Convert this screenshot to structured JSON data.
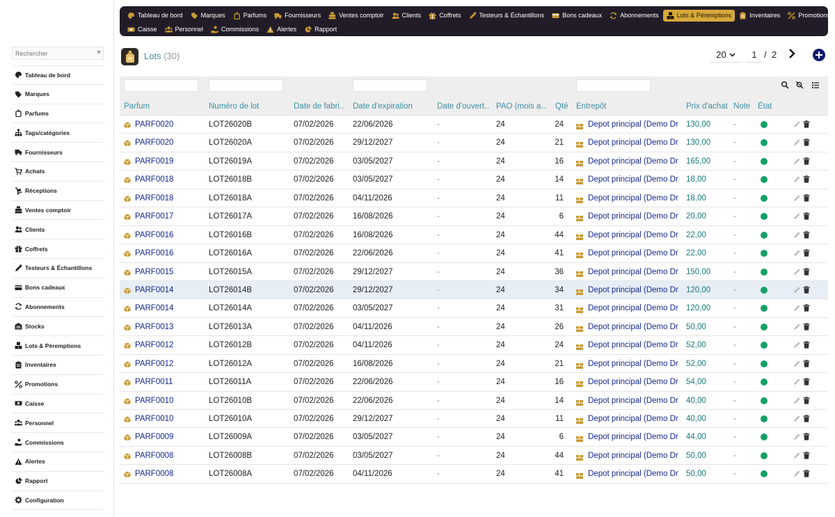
{
  "sidebar": {
    "search_placeholder": "Rechercher",
    "items": [
      {
        "label": "Tableau de bord",
        "icon": "palette-icon"
      },
      {
        "label": "Marques",
        "icon": "tag-icon"
      },
      {
        "label": "Parfums",
        "icon": "perfume-icon"
      },
      {
        "label": "Tags/catégories",
        "icon": "sitemap-icon"
      },
      {
        "label": "Fournisseurs",
        "icon": "truck-icon"
      },
      {
        "label": "Achats",
        "icon": "cart-icon"
      },
      {
        "label": "Réceptions",
        "icon": "dolly-icon"
      },
      {
        "label": "Ventes comptoir",
        "icon": "cash-register-icon"
      },
      {
        "label": "Clients",
        "icon": "users-icon"
      },
      {
        "label": "Coffrets",
        "icon": "gift-icon"
      },
      {
        "label": "Testeurs & Échantillons",
        "icon": "eyedropper-icon"
      },
      {
        "label": "Bons cadeaux",
        "icon": "credit-card-icon"
      },
      {
        "label": "Abonnements",
        "icon": "sync-icon"
      },
      {
        "label": "Stocks",
        "icon": "warehouse-icon"
      },
      {
        "label": "Lots & Péremptions",
        "icon": "boxes-icon"
      },
      {
        "label": "Inventaires",
        "icon": "clipboard-icon"
      },
      {
        "label": "Promotions",
        "icon": "percent-icon"
      },
      {
        "label": "Caisse",
        "icon": "money-icon"
      },
      {
        "label": "Personnel",
        "icon": "people-icon"
      },
      {
        "label": "Commissions",
        "icon": "hand-coin-icon"
      },
      {
        "label": "Alertes",
        "icon": "warning-icon"
      },
      {
        "label": "Rapport",
        "icon": "pie-chart-icon"
      },
      {
        "label": "Configuration",
        "icon": "gear-icon"
      }
    ]
  },
  "topnav": {
    "row1": [
      {
        "label": "Tableau de bord",
        "icon": "palette-icon"
      },
      {
        "label": "Marques",
        "icon": "tag-icon"
      },
      {
        "label": "Parfums",
        "icon": "perfume-icon"
      },
      {
        "label": "Fournisseurs",
        "icon": "truck-icon"
      },
      {
        "label": "Ventes comptoir",
        "icon": "cash-register-icon"
      },
      {
        "label": "Clients",
        "icon": "users-icon"
      },
      {
        "label": "Coffrets",
        "icon": "gift-icon"
      },
      {
        "label": "Testeurs & Échantillons",
        "icon": "eyedropper-icon"
      },
      {
        "label": "Bons cadeaux",
        "icon": "credit-card-icon"
      },
      {
        "label": "Abonnements",
        "icon": "sync-icon"
      },
      {
        "label": "Lots & Péremptions",
        "icon": "boxes-icon",
        "active": true
      },
      {
        "label": "Inventaires",
        "icon": "clipboard-icon"
      },
      {
        "label": "Promotions",
        "icon": "percent-icon"
      }
    ],
    "row2": [
      {
        "label": "Caisse",
        "icon": "money-icon"
      },
      {
        "label": "Personnel",
        "icon": "people-icon"
      },
      {
        "label": "Commissions",
        "icon": "hand-coin-icon"
      },
      {
        "label": "Alertes",
        "icon": "warning-icon"
      },
      {
        "label": "Rapport",
        "icon": "pie-chart-icon"
      }
    ]
  },
  "page": {
    "title": "Lots",
    "count": "(30)"
  },
  "pager": {
    "page_size": "20",
    "current_page": "1",
    "separator": "/",
    "total_pages": "2"
  },
  "table": {
    "columns": [
      "Parfum",
      "Numéro de lot",
      "Date de fabri…",
      "Date d'expiration",
      "Date d'ouvert…",
      "PAO (mois a…",
      "Qté",
      "Entrepôt",
      "Prix d'achat",
      "Note",
      "État"
    ],
    "highlight_index": 9,
    "rows": [
      {
        "parfum": "PARF0020",
        "lot": "LOT26020B",
        "fab": "07/02/2026",
        "exp": "22/06/2026",
        "ouv": "-",
        "pao": "24",
        "qte": "24",
        "entrepot": "Depot principal (Demo Dr…",
        "prix": "130,00",
        "note": "-"
      },
      {
        "parfum": "PARF0020",
        "lot": "LOT26020A",
        "fab": "07/02/2026",
        "exp": "29/12/2027",
        "ouv": "-",
        "pao": "24",
        "qte": "21",
        "entrepot": "Depot principal (Demo Dr…",
        "prix": "130,00",
        "note": "-"
      },
      {
        "parfum": "PARF0019",
        "lot": "LOT26019A",
        "fab": "07/02/2026",
        "exp": "03/05/2027",
        "ouv": "-",
        "pao": "24",
        "qte": "16",
        "entrepot": "Depot principal (Demo Dr…",
        "prix": "165,00",
        "note": "-"
      },
      {
        "parfum": "PARF0018",
        "lot": "LOT26018B",
        "fab": "07/02/2026",
        "exp": "03/05/2027",
        "ouv": "-",
        "pao": "24",
        "qte": "14",
        "entrepot": "Depot principal (Demo Dr…",
        "prix": "18,00",
        "note": "-"
      },
      {
        "parfum": "PARF0018",
        "lot": "LOT26018A",
        "fab": "07/02/2026",
        "exp": "04/11/2026",
        "ouv": "-",
        "pao": "24",
        "qte": "11",
        "entrepot": "Depot principal (Demo Dr…",
        "prix": "18,00",
        "note": "-"
      },
      {
        "parfum": "PARF0017",
        "lot": "LOT26017A",
        "fab": "07/02/2026",
        "exp": "16/08/2026",
        "ouv": "-",
        "pao": "24",
        "qte": "6",
        "entrepot": "Depot principal (Demo Dr…",
        "prix": "20,00",
        "note": "-"
      },
      {
        "parfum": "PARF0016",
        "lot": "LOT26016B",
        "fab": "07/02/2026",
        "exp": "16/08/2026",
        "ouv": "-",
        "pao": "24",
        "qte": "44",
        "entrepot": "Depot principal (Demo Dr…",
        "prix": "22,00",
        "note": "-"
      },
      {
        "parfum": "PARF0016",
        "lot": "LOT26016A",
        "fab": "07/02/2026",
        "exp": "22/06/2026",
        "ouv": "-",
        "pao": "24",
        "qte": "41",
        "entrepot": "Depot principal (Demo Dr…",
        "prix": "22,00",
        "note": "-"
      },
      {
        "parfum": "PARF0015",
        "lot": "LOT26015A",
        "fab": "07/02/2026",
        "exp": "29/12/2027",
        "ouv": "-",
        "pao": "24",
        "qte": "36",
        "entrepot": "Depot principal (Demo Dr…",
        "prix": "150,00",
        "note": "-"
      },
      {
        "parfum": "PARF0014",
        "lot": "LOT26014B",
        "fab": "07/02/2026",
        "exp": "29/12/2027",
        "ouv": "-",
        "pao": "24",
        "qte": "34",
        "entrepot": "Depot principal (Demo Dr…",
        "prix": "120,00",
        "note": "-"
      },
      {
        "parfum": "PARF0014",
        "lot": "LOT26014A",
        "fab": "07/02/2026",
        "exp": "03/05/2027",
        "ouv": "-",
        "pao": "24",
        "qte": "31",
        "entrepot": "Depot principal (Demo Dr…",
        "prix": "120,00",
        "note": "-"
      },
      {
        "parfum": "PARF0013",
        "lot": "LOT26013A",
        "fab": "07/02/2026",
        "exp": "04/11/2026",
        "ouv": "-",
        "pao": "24",
        "qte": "26",
        "entrepot": "Depot principal (Demo Dr…",
        "prix": "50,00",
        "note": "-"
      },
      {
        "parfum": "PARF0012",
        "lot": "LOT26012B",
        "fab": "07/02/2026",
        "exp": "04/11/2026",
        "ouv": "-",
        "pao": "24",
        "qte": "24",
        "entrepot": "Depot principal (Demo Dr…",
        "prix": "52,00",
        "note": "-"
      },
      {
        "parfum": "PARF0012",
        "lot": "LOT26012A",
        "fab": "07/02/2026",
        "exp": "16/08/2026",
        "ouv": "-",
        "pao": "24",
        "qte": "21",
        "entrepot": "Depot principal (Demo Dr…",
        "prix": "52,00",
        "note": "-"
      },
      {
        "parfum": "PARF0011",
        "lot": "LOT26011A",
        "fab": "07/02/2026",
        "exp": "22/06/2026",
        "ouv": "-",
        "pao": "24",
        "qte": "16",
        "entrepot": "Depot principal (Demo Dr…",
        "prix": "54,00",
        "note": "-"
      },
      {
        "parfum": "PARF0010",
        "lot": "LOT26010B",
        "fab": "07/02/2026",
        "exp": "22/06/2026",
        "ouv": "-",
        "pao": "24",
        "qte": "14",
        "entrepot": "Depot principal (Demo Dr…",
        "prix": "40,00",
        "note": "-"
      },
      {
        "parfum": "PARF0010",
        "lot": "LOT26010A",
        "fab": "07/02/2026",
        "exp": "29/12/2027",
        "ouv": "-",
        "pao": "24",
        "qte": "11",
        "entrepot": "Depot principal (Demo Dr…",
        "prix": "40,00",
        "note": "-"
      },
      {
        "parfum": "PARF0009",
        "lot": "LOT26009A",
        "fab": "07/02/2026",
        "exp": "03/05/2027",
        "ouv": "-",
        "pao": "24",
        "qte": "6",
        "entrepot": "Depot principal (Demo Dr…",
        "prix": "44,00",
        "note": "-"
      },
      {
        "parfum": "PARF0008",
        "lot": "LOT26008B",
        "fab": "07/02/2026",
        "exp": "03/05/2027",
        "ouv": "-",
        "pao": "24",
        "qte": "44",
        "entrepot": "Depot principal (Demo Dr…",
        "prix": "50,00",
        "note": "-"
      },
      {
        "parfum": "PARF0008",
        "lot": "LOT26008A",
        "fab": "07/02/2026",
        "exp": "04/11/2026",
        "ouv": "-",
        "pao": "24",
        "qte": "41",
        "entrepot": "Depot principal (Demo Dr…",
        "prix": "50,00",
        "note": "-"
      }
    ]
  },
  "colors": {
    "nav_bg": "#221c28",
    "nav_active": "#d6a83a",
    "header_text": "#3d8fa3",
    "link": "#14288c",
    "price": "#167a7a",
    "state_ok": "#16a068",
    "icon_gold": "#c79a32",
    "add_button": "#111c6a"
  }
}
